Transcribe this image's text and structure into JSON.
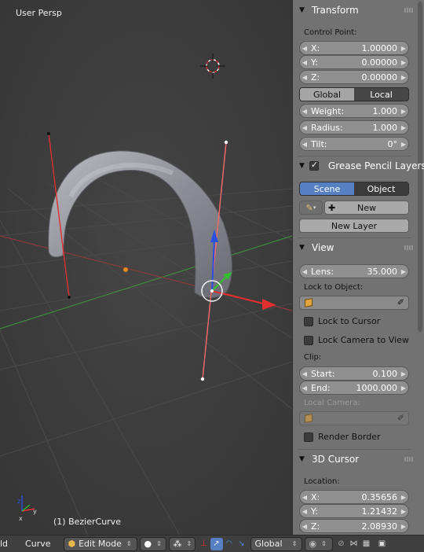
{
  "viewport": {
    "label": "User Persp",
    "object_label": "(1) BezierCurve"
  },
  "transform": {
    "title": "Transform",
    "control_point_label": "Control Point:",
    "x": {
      "key": "X:",
      "value": "1.00000"
    },
    "y": {
      "key": "Y:",
      "value": "0.00000"
    },
    "z": {
      "key": "Z:",
      "value": "0.00000"
    },
    "global_label": "Global",
    "local_label": "Local",
    "weight": {
      "key": "Weight:",
      "value": "1.000"
    },
    "radius": {
      "key": "Radius:",
      "value": "1.000"
    },
    "tilt": {
      "key": "Tilt:",
      "value": "0°"
    }
  },
  "grease_pencil": {
    "title": "Grease Pencil Layers",
    "scene_label": "Scene",
    "object_label": "Object",
    "new_label": "New",
    "new_layer_label": "New Layer"
  },
  "view": {
    "title": "View",
    "lens": {
      "key": "Lens:",
      "value": "35.000"
    },
    "lock_to_object_label": "Lock to Object:",
    "lock_to_cursor_label": "Lock to Cursor",
    "lock_camera_label": "Lock Camera to View",
    "clip_label": "Clip:",
    "start": {
      "key": "Start:",
      "value": "0.100"
    },
    "end": {
      "key": "End:",
      "value": "1000.000"
    },
    "local_camera_label": "Local Camera:",
    "render_border_label": "Render Border"
  },
  "cursor": {
    "title": "3D Cursor",
    "location_label": "Location:",
    "x": {
      "key": "X:",
      "value": "0.35656"
    },
    "y": {
      "key": "Y:",
      "value": "1.21432"
    },
    "z": {
      "key": "Z:",
      "value": "2.08930"
    }
  },
  "footer": {
    "add_label": "ld",
    "curve_label": "Curve",
    "mode_label": "Edit Mode",
    "orientation_label": "Global"
  },
  "colors": {
    "accent": "#5680c2",
    "x_axis": "#e03030",
    "y_axis": "#40c040",
    "z_axis": "#2a50e0"
  }
}
